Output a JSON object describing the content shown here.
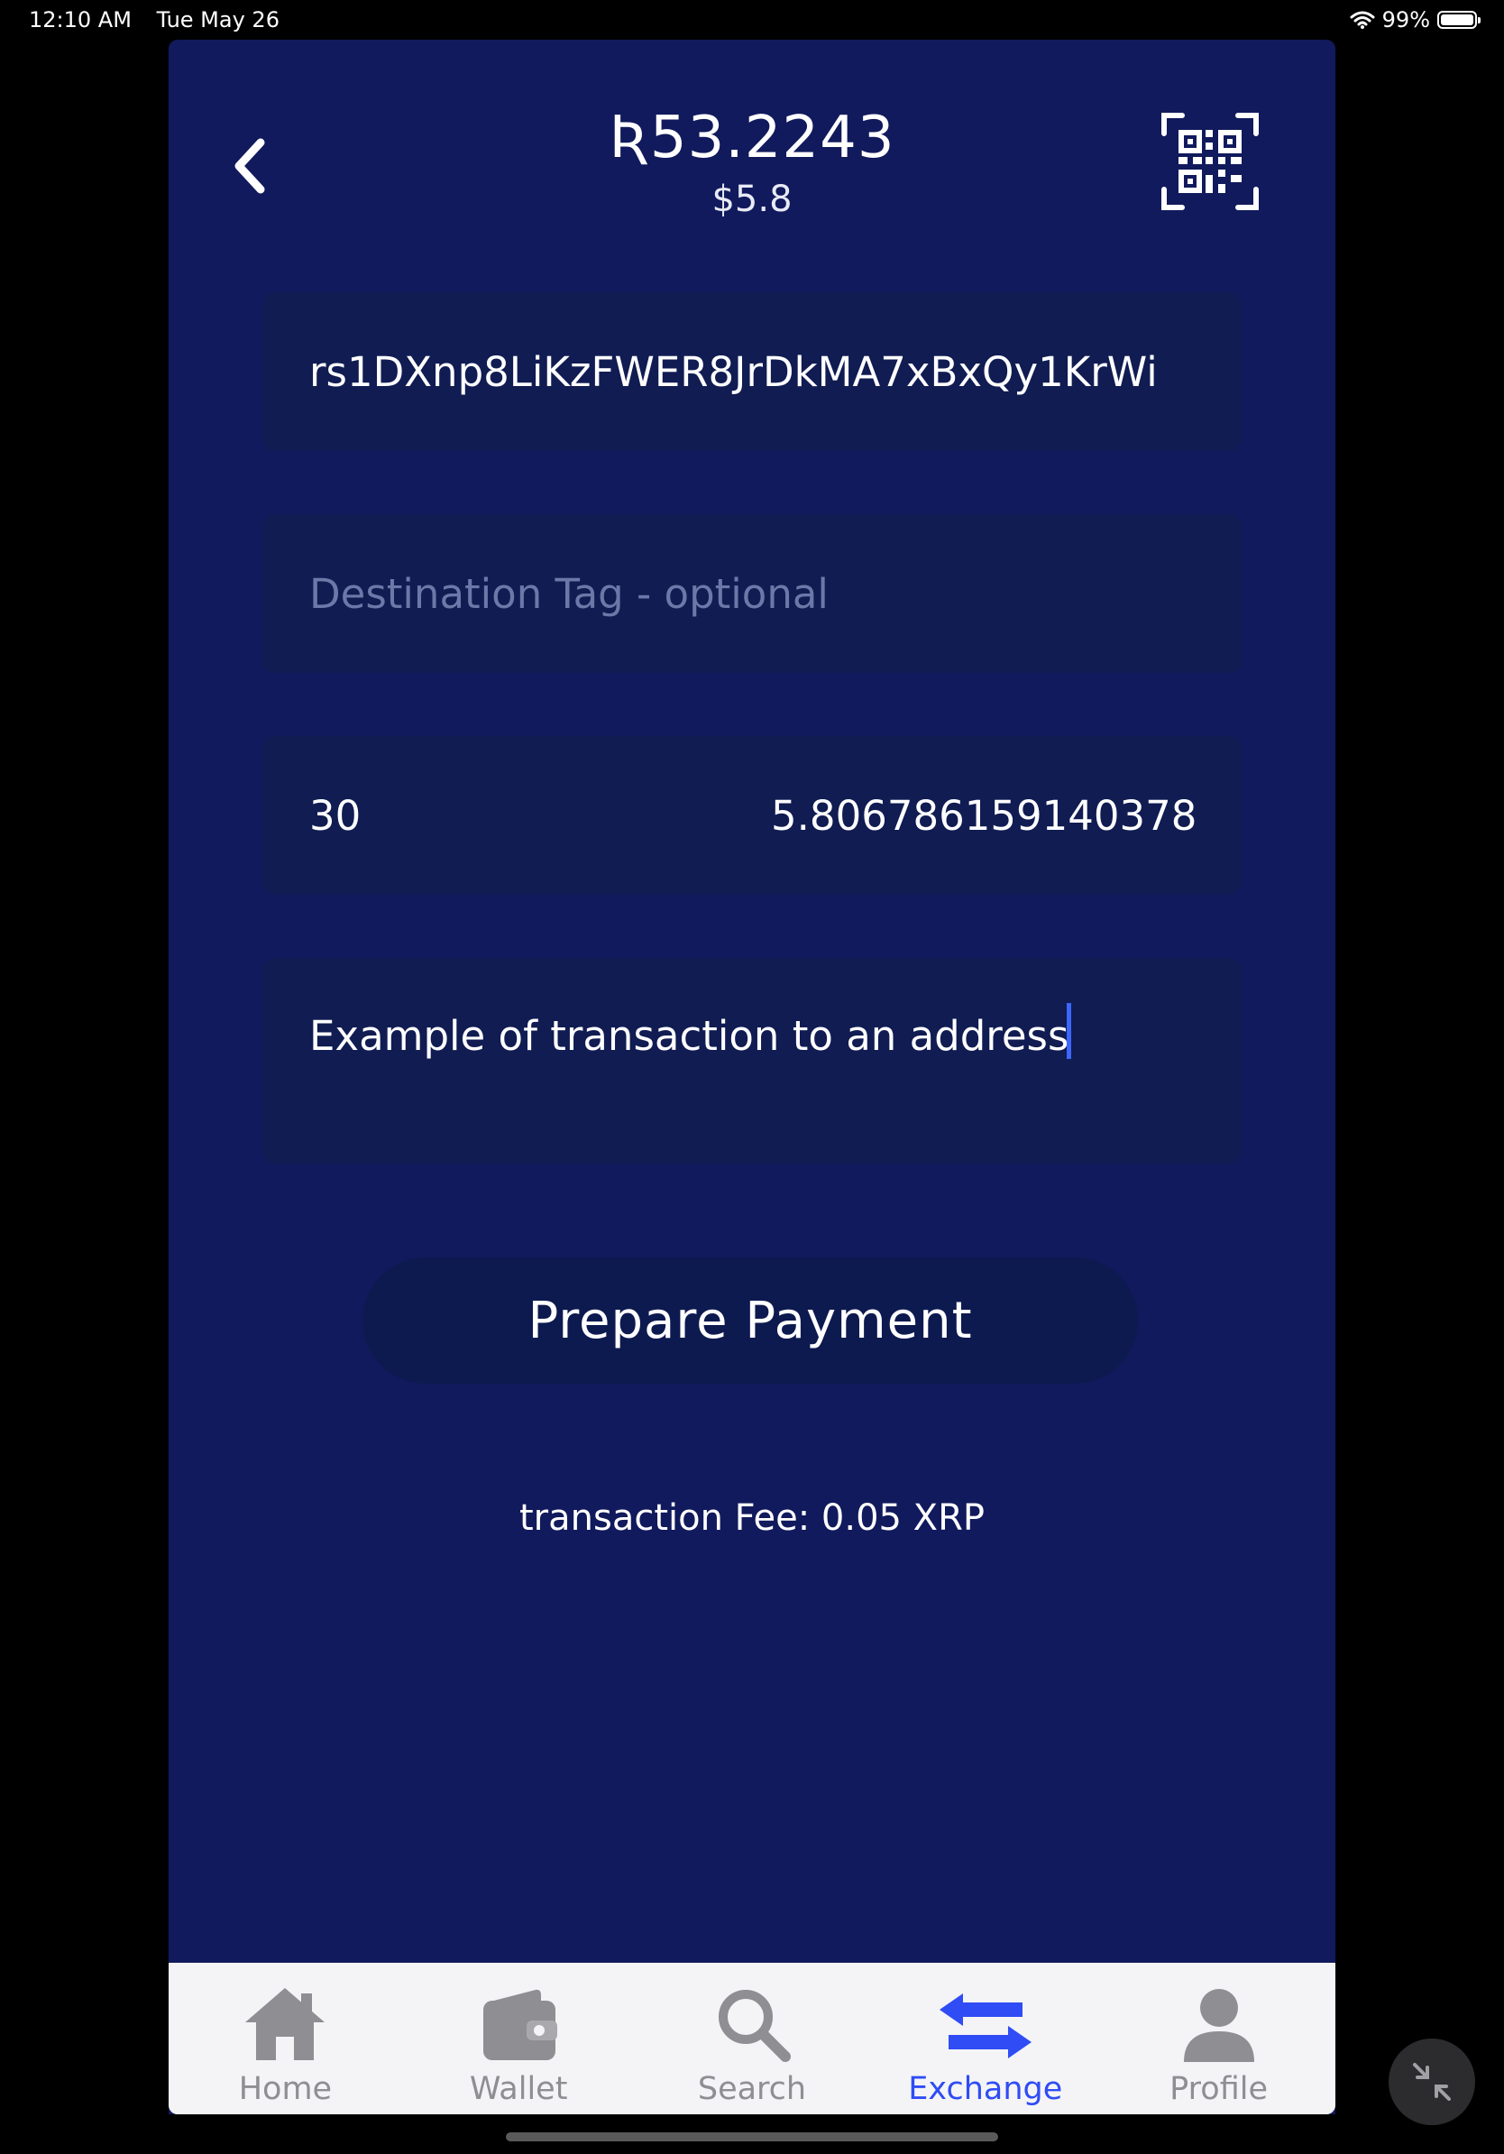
{
  "status": {
    "time": "12:10 AM",
    "date": "Tue May 26",
    "battery": "99%",
    "battery_level": 0.99
  },
  "header": {
    "balance": "Ʀ53.2243",
    "fiat": "$5.8"
  },
  "form": {
    "address": "rs1DXnp8LiKzFWER8JrDkMA7xBxQy1KrWi",
    "tag_placeholder": "Destination Tag - optional",
    "amount": "30",
    "amount_converted": "5.806786159140378",
    "memo": "Example of transaction to an address"
  },
  "actions": {
    "prepare": "Prepare Payment"
  },
  "fee": "transaction Fee: 0.05 XRP",
  "tabs": [
    {
      "label": "Home",
      "icon": "home-icon",
      "active": false
    },
    {
      "label": "Wallet",
      "icon": "wallet-icon",
      "active": false
    },
    {
      "label": "Search",
      "icon": "search-icon",
      "active": false
    },
    {
      "label": "Exchange",
      "icon": "exchange-icon",
      "active": true
    },
    {
      "label": "Profile",
      "icon": "profile-icon",
      "active": false
    }
  ],
  "colors": {
    "background": "#111a5c",
    "field": "#101c52",
    "active_tab": "#2f4cf5",
    "caret": "#3d66ff"
  }
}
